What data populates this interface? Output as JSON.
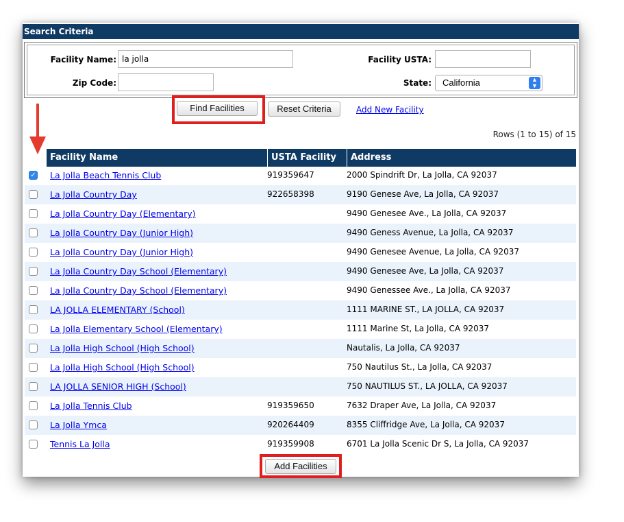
{
  "search_header": "Search Criteria",
  "fields": {
    "facility_name_label": "Facility Name:",
    "facility_name_value": "la jolla",
    "facility_usta_label": "Facility USTA:",
    "facility_usta_value": "",
    "zip_code_label": "Zip Code:",
    "zip_code_value": "",
    "state_label": "State:",
    "state_value": "California"
  },
  "actions": {
    "find": "Find Facilities",
    "reset": "Reset Criteria",
    "add_new": "Add New Facility",
    "add_facilities": "Add Facilities"
  },
  "rows_info": "Rows (1 to 15) of 15",
  "table": {
    "headers": [
      "Facility Name",
      "USTA Facility",
      "Address"
    ],
    "rows": [
      {
        "name": "La Jolla Beach Tennis Club",
        "usta": "919359647",
        "address": "2000 Spindrift Dr, La Jolla, CA 92037",
        "checked": true
      },
      {
        "name": "La Jolla Country Day",
        "usta": "922658398",
        "address": "9190 Genese Ave, La Jolla, CA 92037",
        "checked": false
      },
      {
        "name": "La Jolla Country Day (Elementary)",
        "usta": "",
        "address": "9490 Genesee Ave., La Jolla, CA 92037",
        "checked": false
      },
      {
        "name": "La Jolla Country Day (Junior High)",
        "usta": "",
        "address": "9490 Geness Avenue, La Jolla, CA 92037",
        "checked": false
      },
      {
        "name": "La Jolla Country Day (Junior High)",
        "usta": "",
        "address": "9490 Genesee Avenue, La Jolla, CA 92037",
        "checked": false
      },
      {
        "name": "La Jolla Country Day School (Elementary)",
        "usta": "",
        "address": "9490 Genesee Ave, La Jolla, CA 92037",
        "checked": false
      },
      {
        "name": "La Jolla Country Day School (Elementary)",
        "usta": "",
        "address": "9490 Genessee Ave., La Jolla, CA 92037",
        "checked": false
      },
      {
        "name": "LA JOLLA ELEMENTARY (School)",
        "usta": "",
        "address": "1111 MARINE ST., LA JOLLA, CA 92037",
        "checked": false
      },
      {
        "name": "La Jolla Elementary School (Elementary)",
        "usta": "",
        "address": "1111 Marine St, La Jolla, CA 92037",
        "checked": false
      },
      {
        "name": "La Jolla High School (High School)",
        "usta": "",
        "address": "Nautalis, La Jolla, CA 92037",
        "checked": false
      },
      {
        "name": "La Jolla High School (High School)",
        "usta": "",
        "address": "750 Nautilus St., La Jolla, CA 92037",
        "checked": false
      },
      {
        "name": "LA JOLLA SENIOR HIGH (School)",
        "usta": "",
        "address": "750 NAUTILUS ST., LA JOLLA, CA 92037",
        "checked": false
      },
      {
        "name": "La Jolla Tennis Club",
        "usta": "919359650",
        "address": "7632 Draper Ave, La Jolla, CA 92037",
        "checked": false
      },
      {
        "name": "La Jolla Ymca",
        "usta": "920264409",
        "address": "8355 Cliffridge Ave, La Jolla, CA 92037",
        "checked": false
      },
      {
        "name": "Tennis La Jolla",
        "usta": "919359908",
        "address": "6701 La Jolla Scenic Dr S, La Jolla, CA 92037",
        "checked": false
      }
    ]
  },
  "colors": {
    "header_bg": "#0f3a64",
    "highlight": "#e01e1e",
    "link": "#0000ee",
    "checkbox_checked": "#2f86ef"
  },
  "icons": [
    "checkmark-icon",
    "select-arrows-icon",
    "red-down-arrow-icon"
  ]
}
